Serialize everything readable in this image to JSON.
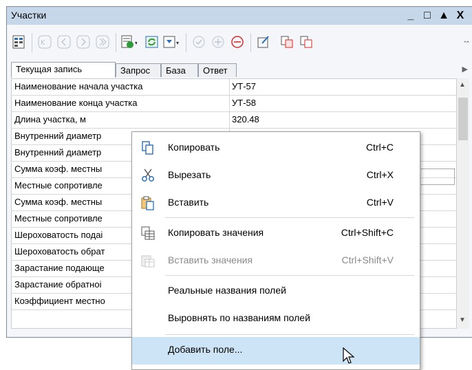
{
  "window": {
    "title": "Участки"
  },
  "titlebar_buttons": [
    "_",
    "□",
    "▲",
    "X"
  ],
  "toolbar": {
    "icons": [
      "fields-icon",
      "first-record-icon",
      "prev-record-icon",
      "next-record-icon",
      "last-record-icon",
      "form-view-icon",
      "refresh-icon",
      "filter-icon",
      "apply-icon",
      "add-record-icon",
      "delete-record-icon",
      "edit-icon",
      "copy-record-icon",
      "paste-record-icon"
    ]
  },
  "tabs": [
    {
      "label": "Текущая запись",
      "active": true
    },
    {
      "label": "Запрос",
      "active": false
    },
    {
      "label": "База",
      "active": false
    },
    {
      "label": "Ответ",
      "active": false
    }
  ],
  "rows": [
    {
      "name": "Наименование начала участка",
      "value": "УТ-57"
    },
    {
      "name": "Наименование конца участка",
      "value": "УТ-58"
    },
    {
      "name": "Длина участка, м",
      "value": "320.48"
    },
    {
      "name": "Внутренний диаметр",
      "value": ""
    },
    {
      "name": "Внутренний диаметр",
      "value": ""
    },
    {
      "name": "Сумма коэф. местны",
      "value": ""
    },
    {
      "name": "Местные сопротивле",
      "value": ""
    },
    {
      "name": "Сумма коэф. местны",
      "value": ""
    },
    {
      "name": "Местные сопротивле",
      "value": ""
    },
    {
      "name": "Шероховатость подаі",
      "value": ""
    },
    {
      "name": "Шероховатость обрат",
      "value": ""
    },
    {
      "name": "Зарастание подающе",
      "value": ""
    },
    {
      "name": "Зарастание обратноі",
      "value": ""
    },
    {
      "name": "Коэффициент местно",
      "value": ""
    }
  ],
  "context_menu": {
    "copy": {
      "label": "Копировать",
      "shortcut": "Ctrl+C"
    },
    "cut": {
      "label": "Вырезать",
      "shortcut": "Ctrl+X"
    },
    "paste": {
      "label": "Вставить",
      "shortcut": "Ctrl+V"
    },
    "copy_values": {
      "label": "Копировать значения",
      "shortcut": "Ctrl+Shift+C"
    },
    "paste_values": {
      "label": "Вставить значения",
      "shortcut": "Ctrl+Shift+V"
    },
    "real_names": {
      "label": "Реальные названия полей"
    },
    "align_names": {
      "label": "Выровнять по названиям полей"
    },
    "add_field": {
      "label": "Добавить поле..."
    }
  },
  "colors": {
    "titlebar": "#c6d7ea",
    "highlight": "#cde4f7",
    "accent_red": "#d92a2a",
    "accent_blue": "#2a6fb6",
    "accent_green": "#2f9a3a"
  }
}
